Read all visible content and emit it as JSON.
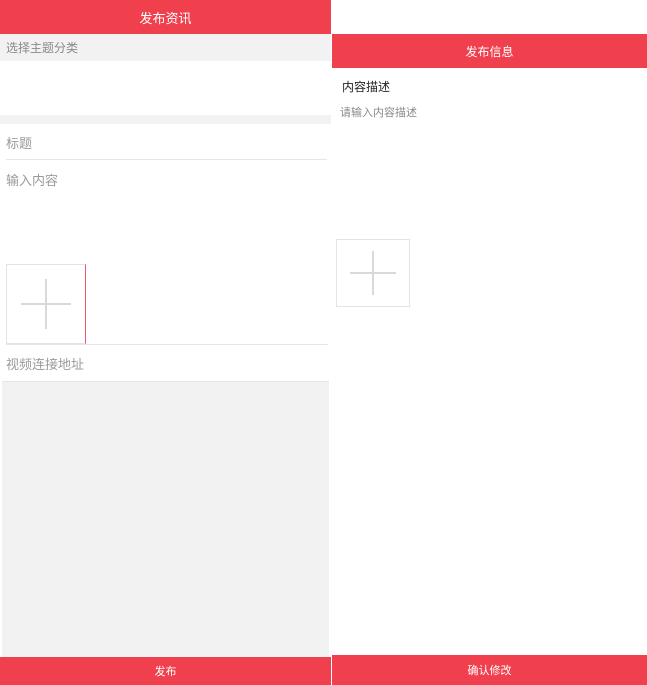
{
  "left_panel": {
    "header_title": "发布资讯",
    "category_placeholder": "选择主题分类",
    "title_placeholder": "标题",
    "content_placeholder": "输入内容",
    "video_placeholder": "视频连接地址",
    "publish_label": "发布"
  },
  "right_panel": {
    "header_title": "发布信息",
    "description_label": "内容描述",
    "description_placeholder": "请输入内容描述",
    "confirm_label": "确认修改"
  },
  "colors": {
    "accent": "#f0404d",
    "panel_gray": "#f2f2f2"
  }
}
